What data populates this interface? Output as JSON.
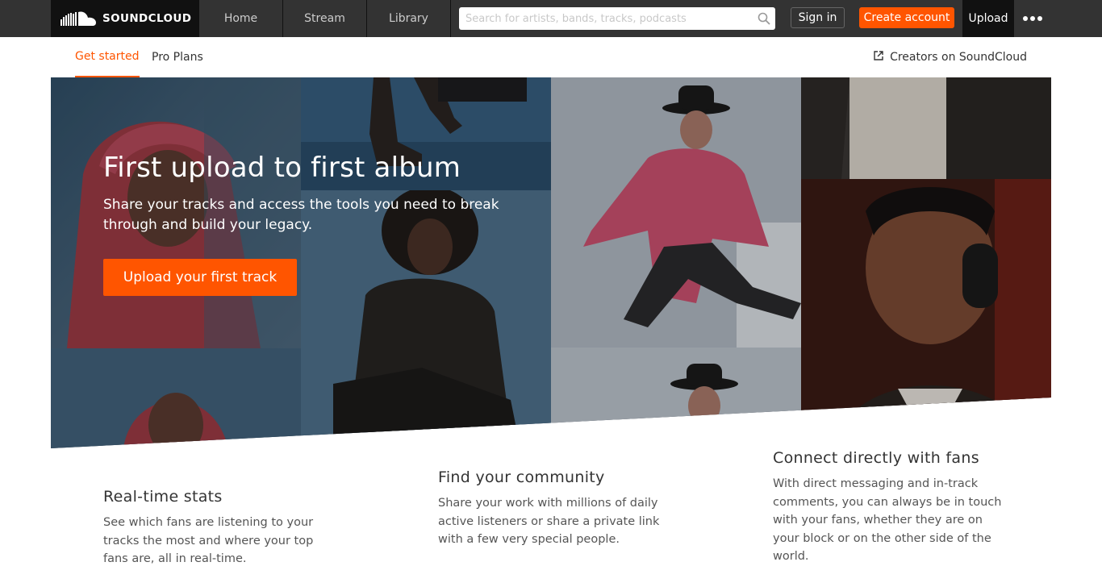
{
  "header": {
    "logo_text": "SOUNDCLOUD",
    "nav": [
      {
        "label": "Home"
      },
      {
        "label": "Stream"
      },
      {
        "label": "Library"
      }
    ],
    "search_placeholder": "Search for artists, bands, tracks, podcasts",
    "sign_in_label": "Sign in",
    "create_account_label": "Create account",
    "upload_label": "Upload",
    "more_icon": "more-dots-icon",
    "accent_color": "#ff5500"
  },
  "subnav": {
    "tabs": [
      {
        "label": "Get started",
        "active": true
      },
      {
        "label": "Pro Plans",
        "active": false
      }
    ],
    "creators_link": "Creators on SoundCloud",
    "creators_icon": "external-link-icon"
  },
  "hero": {
    "title": "First upload to first album",
    "subtitle": "Share your tracks and access the tools you need to break through and build your legacy.",
    "cta_label": "Upload your first track"
  },
  "features": [
    {
      "title": "Real-time stats",
      "body": "See which fans are listening to your tracks the most and where your top fans are, all in real-time."
    },
    {
      "title": "Find your community",
      "body": "Share your work with millions of daily active listeners or share a private link with a few very special people."
    },
    {
      "title": "Connect directly with fans",
      "body": "With direct messaging and in-track comments, you can always be in touch with your fans, whether they are on your block or on the other side of the world."
    }
  ]
}
